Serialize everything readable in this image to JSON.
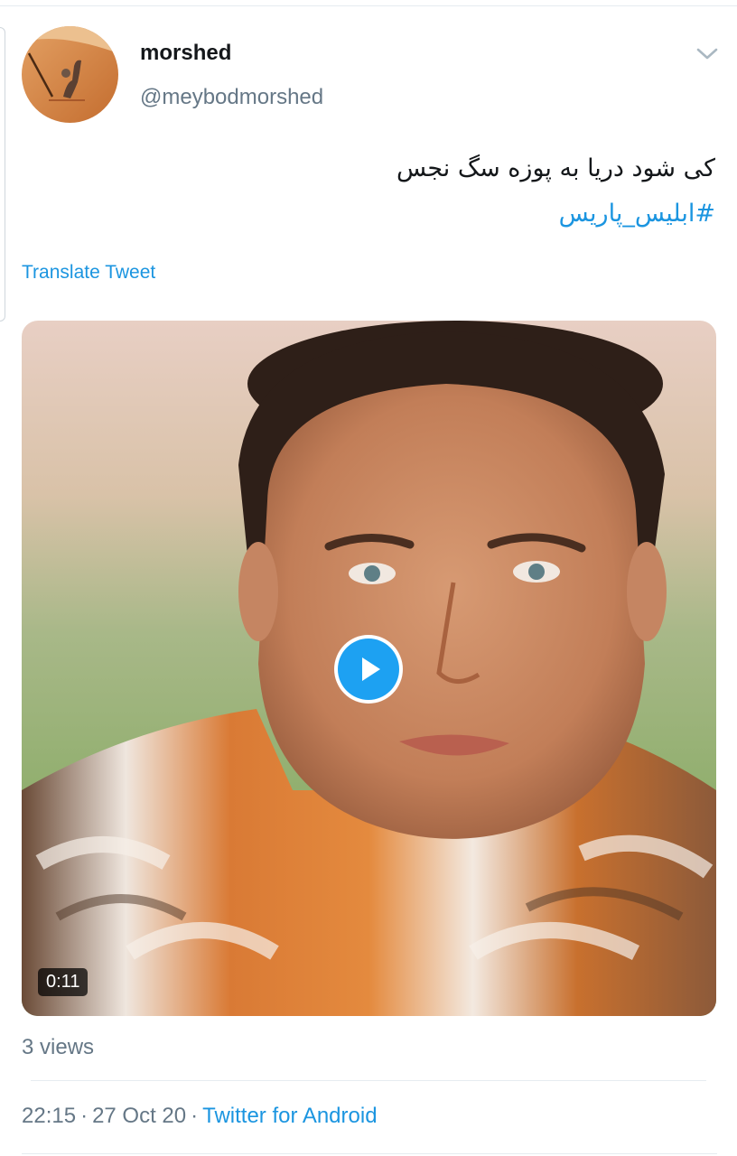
{
  "tweet": {
    "author": {
      "display_name": "morshed",
      "handle": "@meybodmorshed",
      "avatar": "desert-camel-avatar"
    },
    "text": "کی شود دریا به پوزه سگ نجس",
    "hashtag": "#ابلیس_پاریس",
    "translate_label": "Translate Tweet",
    "media": {
      "type": "video",
      "duration": "0:11",
      "play_icon": "play-icon"
    },
    "views": "3 views",
    "meta": {
      "time": "22:15",
      "separator": "·",
      "date": "27 Oct 20",
      "source": "Twitter for Android"
    }
  },
  "colors": {
    "link": "#1b95e0",
    "secondary_text": "#657786",
    "play_button": "#1da1f2",
    "divider": "#e6ecf0"
  },
  "icons": {
    "menu": "chevron-down-icon",
    "play": "play-icon"
  }
}
